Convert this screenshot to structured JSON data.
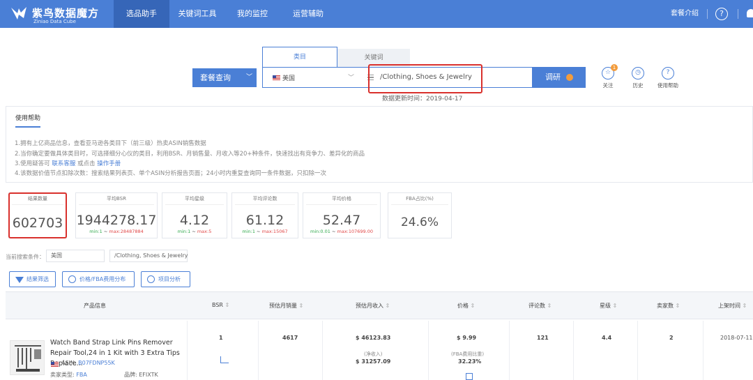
{
  "header": {
    "logo_title": "紫鸟数据魔方",
    "logo_sub": "Ziniao Data Cube",
    "nav": [
      "选品助手",
      "关键词工具",
      "我的监控",
      "运营辅助"
    ],
    "right_link": "套餐介绍",
    "help_glyph": "?"
  },
  "search": {
    "tabs": [
      "类目",
      "关键词"
    ],
    "package_button": "套餐查询",
    "country": "美国",
    "category": "/Clothing, Shoes & Jewelry",
    "research_button": "调研",
    "update_time": "数据更新时间：2019-04-17",
    "tools": [
      {
        "label": "关注",
        "icon": "star-icon",
        "badge": "1"
      },
      {
        "label": "历史",
        "icon": "clock-icon"
      },
      {
        "label": "使用帮助",
        "icon": "question-icon"
      }
    ]
  },
  "help": {
    "title": "使用帮助",
    "lines": [
      "1.拥有上亿商品信息，查看亚马逊各类目下（前三级）热卖ASIN销售数据",
      "2.当你确定要做具体类目时，可选择细分心仪的类目，利用BSR、月销售量、月收入等20+种条件，快速找出有竞争力、差异化的商品"
    ],
    "line3_prefix": "3.使用疑答可",
    "line3_link1": "联系客服",
    "line3_mid": "或点击",
    "line3_link2": "操作手册",
    "line4": "4.该数据价值节点扣除次数：搜索结果列表页、单个ASIN分析报告页面；24小时内重复查询同一条件数据，只扣除一次"
  },
  "stats": [
    {
      "label": "结果数量",
      "value": "602703"
    },
    {
      "label": "平均BSR",
      "value": "1944278.17",
      "min": "min:1",
      "max": "max:28487884"
    },
    {
      "label": "平均星级",
      "value": "4.12",
      "min": "min:1",
      "max": "max:5"
    },
    {
      "label": "平均评论数",
      "value": "61.12",
      "min": "min:1",
      "max": "max:15067"
    },
    {
      "label": "平均价格",
      "value": "52.47",
      "min": "min:0.01",
      "max": "max:107699.00"
    },
    {
      "label": "FBA占比(%)",
      "value": "24.6%"
    }
  ],
  "conditions": {
    "label": "当前搜索条件：",
    "country": "美国",
    "category": "/Clothing, Shoes & Jewelry"
  },
  "actions": [
    "结果筛选",
    "价格/FBA费用分布",
    "项目分析"
  ],
  "table": {
    "headers": [
      "产品信息",
      "BSR",
      "预估月销量",
      "预估月收入",
      "价格",
      "评论数",
      "星级",
      "卖家数",
      "上架时间"
    ],
    "sort_glyph": "⇕",
    "row": {
      "title": "Watch Band Strap Link Pins Remover Repair Tool,24 in 1 Kit with 3 Extra Tips Replace...",
      "asin_label": "ASIN:",
      "asin": "B07FDNP55K",
      "seller_type_label": "卖家类型:",
      "seller_type": "FBA",
      "brand_label": "品牌:",
      "brand": "EFIXTK",
      "bsr": "1",
      "monthly_sales": "4617",
      "monthly_revenue": "$ 46123.83",
      "net_label": "(净收入)",
      "net_revenue": "$ 31257.09",
      "price": "$ 9.99",
      "fba_label": "(FBA费用比重)",
      "fba_ratio": "32.23%",
      "reviews": "121",
      "rating": "4.4",
      "sellers": "2",
      "listed": "2018-07-11"
    }
  },
  "colors": {
    "brand": "#4a7fd6",
    "highlight": "#d9302c",
    "min": "#2ea84a",
    "max": "#e04747"
  }
}
